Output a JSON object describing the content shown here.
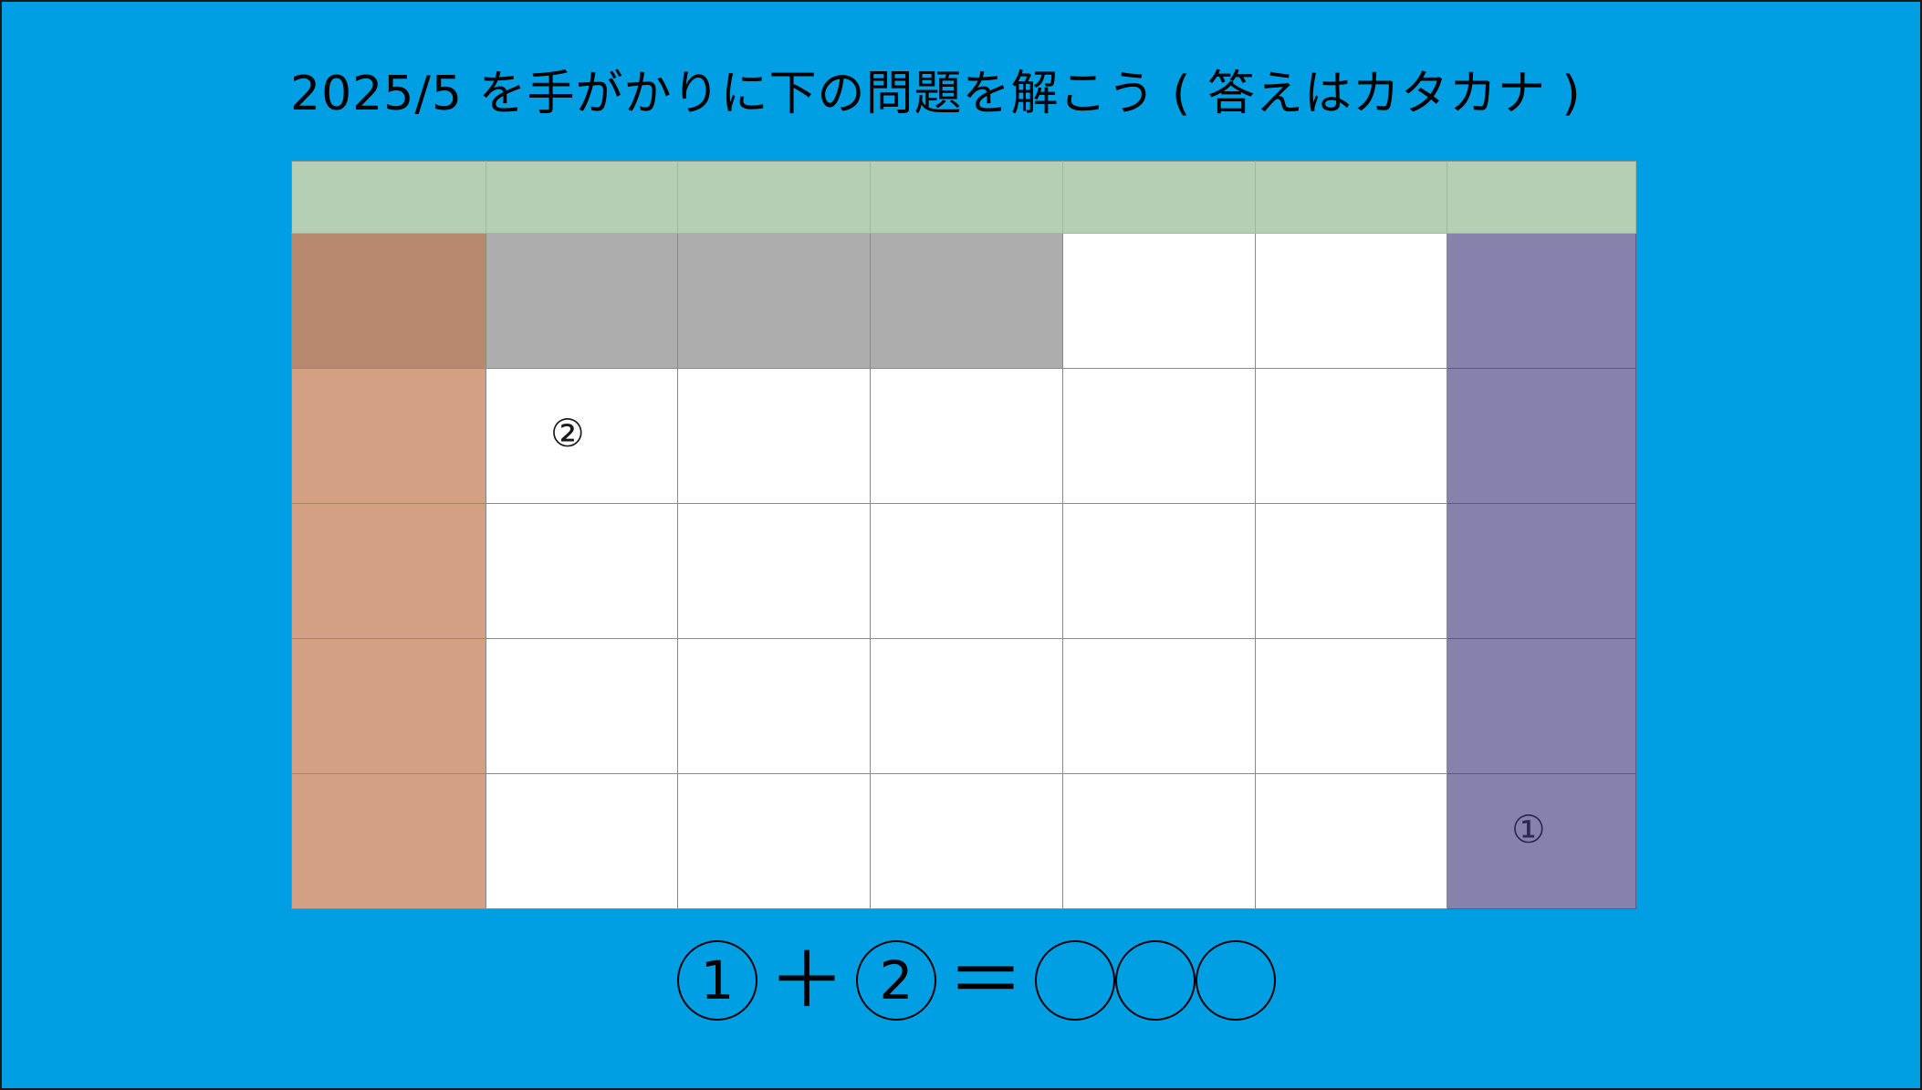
{
  "title": "2025/5 を手がかりに下の問題を解こう ( 答えはカタカナ )",
  "grid": {
    "marker_two": "②",
    "marker_one": "①"
  },
  "equation": {
    "term1": "1",
    "plus": "＋",
    "term2": "2",
    "equals": "＝"
  },
  "colors": {
    "background": "#009fe3",
    "header_row": "#b5cfb4",
    "left_column_top": "#b8896e",
    "left_column": "#d4a083",
    "gray_cells": "#adadad",
    "right_column": "#8782ad"
  }
}
